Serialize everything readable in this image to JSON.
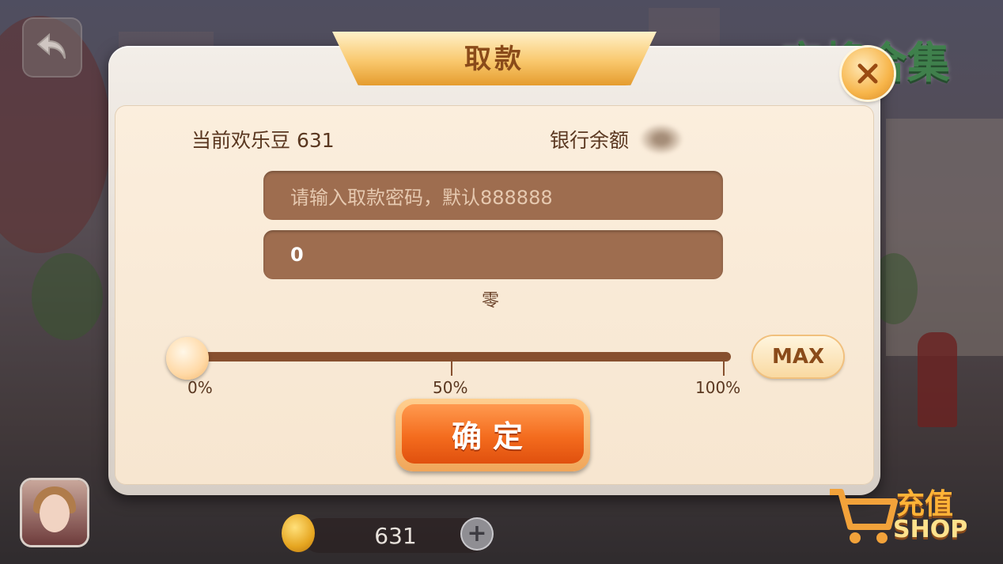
{
  "dialog": {
    "title": "取款",
    "current_beans_label": "当前欢乐豆",
    "current_beans_value": "631",
    "bank_balance_label": "银行余额",
    "password_placeholder": "请输入取款密码，默认888888",
    "amount_value": "0",
    "amount_chinese": "零",
    "slider": {
      "value_percent": 0,
      "ticks": [
        "0%",
        "50%",
        "100%"
      ]
    },
    "max_label": "MAX",
    "confirm_label": "确定"
  },
  "logo_text": "麻将合集",
  "footer": {
    "coin_balance": "631",
    "plus_label": "+",
    "shop_label_cn": "充值",
    "shop_label_en": "SHOP"
  },
  "icons": [
    "back-arrow-icon",
    "close-icon",
    "coin-icon",
    "plus-icon",
    "shopping-cart-icon",
    "avatar"
  ]
}
